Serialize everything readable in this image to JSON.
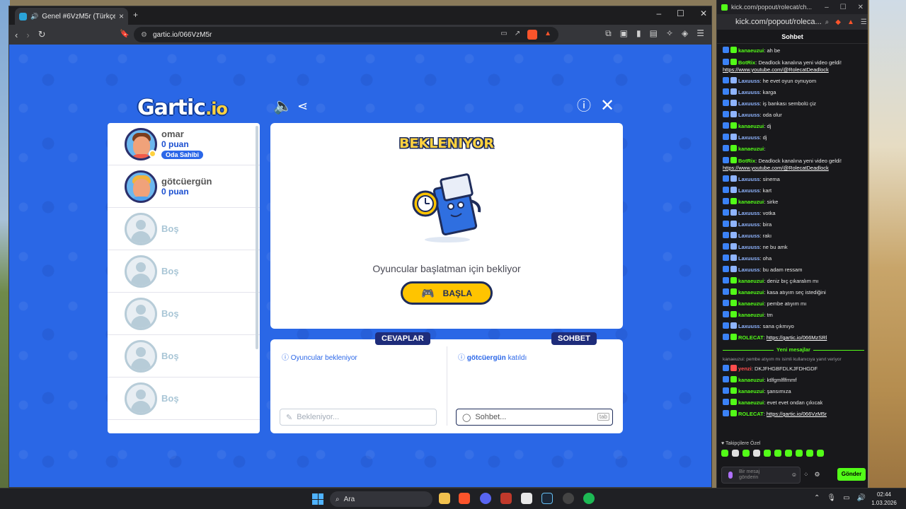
{
  "browser": {
    "tab_title": "Genel #6VzM5r (Türkçe) - Gar",
    "url": "gartic.io/066VzM5r",
    "brave_count": "6",
    "alert_count": "8"
  },
  "game": {
    "logo_main": "Gartic",
    "logo_suffix": ".io",
    "wait_title": "BEKLENIYOR",
    "wait_message": "Oyuncular başlatman için bekliyor",
    "start_label": "BAŞLA",
    "players": [
      {
        "name": "omar",
        "points": "0 puan",
        "badge": "Oda Sahibi"
      },
      {
        "name": "götcüergün",
        "points": "0 puan"
      }
    ],
    "empty_slots": [
      "Boş",
      "Boş",
      "Boş",
      "Boş",
      "Boş"
    ],
    "answers_tab": "CEVAPLAR",
    "chat_tab": "SOHBET",
    "answers_status": "Oyuncular bekleniyor",
    "chat_status_user": "götcüergün",
    "chat_status_text": "katıldı",
    "answer_placeholder": "Bekleniyor...",
    "chat_placeholder": "Sohbet...",
    "tab_key": "tab"
  },
  "kick": {
    "window_title": "kick.com/popout/rolecat/ch...",
    "url": "kick.com/popout/roleca...",
    "header": "Sohbet",
    "messages": [
      {
        "user": "kanaeuzui",
        "color": "#53fc18",
        "text": "ah be"
      },
      {
        "user": "BotRix",
        "color": "#53fc18",
        "text": "Deadlock kanalına yeni video geldi!",
        "link": "https://www.youtube.com/@RolecatDeadlock"
      },
      {
        "user": "Laxuuss",
        "color": "#8fb4ff",
        "text": "he evet oyun oynuyom"
      },
      {
        "user": "Laxuuss",
        "color": "#8fb4ff",
        "text": "karga"
      },
      {
        "user": "Laxuuss",
        "color": "#8fb4ff",
        "text": "iş bankası sembolü çiz"
      },
      {
        "user": "Laxuuss",
        "color": "#8fb4ff",
        "text": "oda olur"
      },
      {
        "user": "kanaeuzui",
        "color": "#53fc18",
        "text": "dj"
      },
      {
        "user": "Laxuuss",
        "color": "#8fb4ff",
        "text": "dj"
      },
      {
        "user": "kanaeuzui",
        "color": "#53fc18",
        "text": ""
      },
      {
        "user": "BotRix",
        "color": "#53fc18",
        "text": "Deadlock kanalına yeni video geldi!",
        "link": "https://www.youtube.com/@RolecatDeadlock"
      },
      {
        "user": "Laxuuss",
        "color": "#8fb4ff",
        "text": "sinema"
      },
      {
        "user": "Laxuuss",
        "color": "#8fb4ff",
        "text": "kart"
      },
      {
        "user": "kanaeuzui",
        "color": "#53fc18",
        "text": "sirke"
      },
      {
        "user": "Laxuuss",
        "color": "#8fb4ff",
        "text": "votka"
      },
      {
        "user": "Laxuuss",
        "color": "#8fb4ff",
        "text": "bira"
      },
      {
        "user": "Laxuuss",
        "color": "#8fb4ff",
        "text": "rakı"
      },
      {
        "user": "Laxuuss",
        "color": "#8fb4ff",
        "text": "ne bu amk"
      },
      {
        "user": "Laxuuss",
        "color": "#8fb4ff",
        "text": "oha"
      },
      {
        "user": "Laxuuss",
        "color": "#8fb4ff",
        "text": "bu adam ressam"
      },
      {
        "user": "kanaeuzui",
        "color": "#53fc18",
        "text": "deniz bıç çıkaralım mı"
      },
      {
        "user": "kanaeuzui",
        "color": "#53fc18",
        "text": "kasa atıyım seç istediğini"
      },
      {
        "user": "kanaeuzui",
        "color": "#53fc18",
        "text": "pembe atıyım mı"
      },
      {
        "user": "kanaeuzui",
        "color": "#53fc18",
        "text": "tm"
      },
      {
        "user": "Laxuuss",
        "color": "#8fb4ff",
        "text": "sana çıkmıyo"
      },
      {
        "user": "ROLECAT",
        "color": "#53fc18",
        "text": "",
        "link": "https://gartic.io/066MzSRl"
      }
    ],
    "new_messages_label": "Yeni mesajlar",
    "reply_note": "kanaeuzui: pembe atıyım mı isimli kullanıcıya yanıt veriyor",
    "new_messages": [
      {
        "user": "yenzi",
        "color": "#ff4d4d",
        "text": "DKJFHGBFDLKJFDHGDF"
      },
      {
        "user": "kanaeuzui",
        "color": "#53fc18",
        "text": "ktlfgmlflfmmf"
      },
      {
        "user": "kanaeuzui",
        "color": "#53fc18",
        "text": "şansımıza"
      },
      {
        "user": "kanaeuzui",
        "color": "#53fc18",
        "text": "evet evet ondan çıkıcak"
      },
      {
        "user": "ROLECAT",
        "color": "#53fc18",
        "text": "",
        "link": "https://gartic.io/066VzM5r"
      }
    ],
    "followers_label": "Takipçilere Özel",
    "composer_placeholder_1": "Bir mesaj",
    "composer_placeholder_2": "gönderin",
    "send_label": "Gönder"
  },
  "taskbar": {
    "search_label": "Ara",
    "time": "02:44",
    "date": "1.03.2026"
  }
}
